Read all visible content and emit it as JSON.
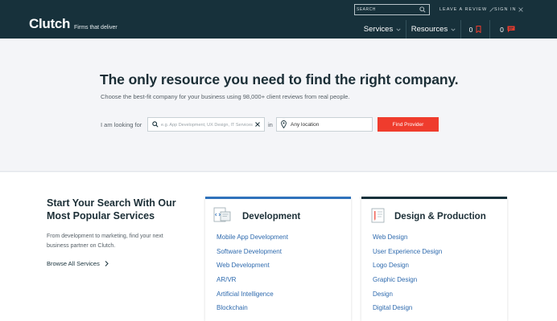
{
  "header": {
    "logo": "Clutch",
    "tagline": "Firms that deliver",
    "search_placeholder": "SEARCH",
    "leave_review": "LEAVE A REVIEW",
    "sign_in": "SIGN IN",
    "nav": {
      "services": "Services",
      "resources": "Resources",
      "shortlist_count": "0",
      "messages_count": "0"
    }
  },
  "hero": {
    "title": "The only resource you need to find the right company.",
    "subtitle": "Choose the best-fit company for your business using 98,000+ client reviews from real people.",
    "looking_label": "I am looking for",
    "service_placeholder": "e.g. App Development, UX Design, IT Services...",
    "in_label": "in",
    "location_value": "Any location",
    "find_button": "Find Provider"
  },
  "popular": {
    "title": "Start Your Search With Our Most Popular Services",
    "description": "From development to marketing, find your next business partner on Clutch.",
    "browse_link": "Browse All Services"
  },
  "cards": {
    "development": {
      "title": "Development",
      "items": [
        "Mobile App Development",
        "Software Development",
        "Web Development",
        "AR/VR",
        "Artificial Intelligence",
        "Blockchain"
      ]
    },
    "design": {
      "title": "Design & Production",
      "items": [
        "Web Design",
        "User Experience Design",
        "Logo Design",
        "Graphic Design",
        "Design",
        "Digital Design"
      ]
    }
  },
  "colors": {
    "header_bg": "#17313b",
    "accent_red": "#ef3c2d",
    "link_blue": "#2e6aae",
    "dev_card_accent": "#2f72bb"
  }
}
